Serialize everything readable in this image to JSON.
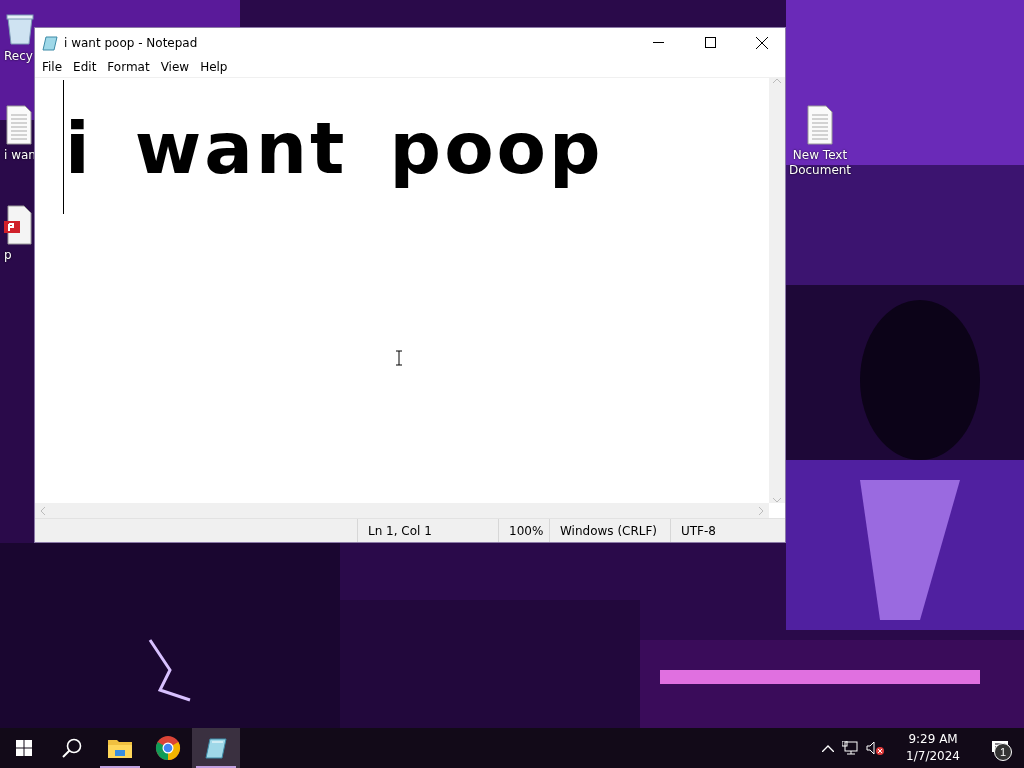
{
  "desktop": {
    "icons": [
      {
        "label": "Recy",
        "kind": "recycle"
      },
      {
        "label": "i wan",
        "kind": "text"
      },
      {
        "label": "p",
        "kind": "pdf"
      },
      {
        "label": "New Text Document",
        "kind": "text"
      }
    ]
  },
  "window": {
    "title": "i want poop - Notepad",
    "menu": [
      "File",
      "Edit",
      "Format",
      "View",
      "Help"
    ],
    "content": "i want poop",
    "status": [
      "Ln 1, Col 1",
      "100%",
      "Windows (CRLF)",
      "UTF-8"
    ]
  },
  "taskbar": {
    "apps": [
      {
        "kind": "explorer",
        "running": true,
        "selected": false
      },
      {
        "kind": "chrome",
        "running": false,
        "selected": false
      },
      {
        "kind": "notepad",
        "running": true,
        "selected": true
      }
    ],
    "time": "9:29 AM",
    "date": "1/7/2024",
    "notifications": "1"
  }
}
